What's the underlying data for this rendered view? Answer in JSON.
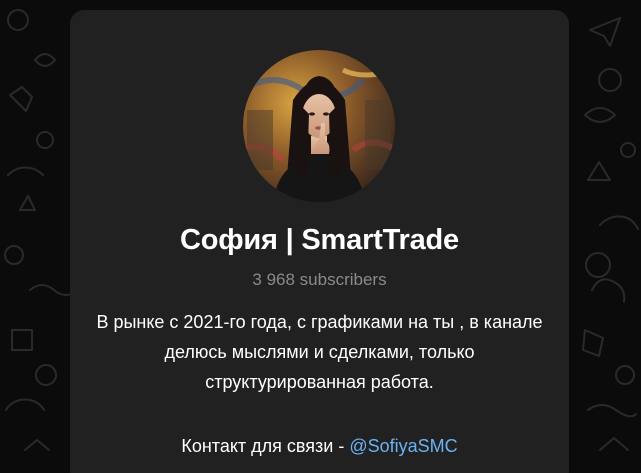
{
  "channel": {
    "title": "София | SmartTrade",
    "subscribers": "3 968 subscribers",
    "description": "В рынке с 2021-го года, с графиками на ты , в каналe делюсь мыслями и сделками, только структурированная работа.",
    "contact_prefix": "Контакт для связи - ",
    "contact_link": "@SofiyaSMC"
  },
  "avatar": {
    "icon": "channel-avatar-photo"
  },
  "colors": {
    "background": "#0b0b0b",
    "card": "#212121",
    "title": "#ffffff",
    "subscribers": "#8a8a8a",
    "link": "#6ab2f2"
  }
}
